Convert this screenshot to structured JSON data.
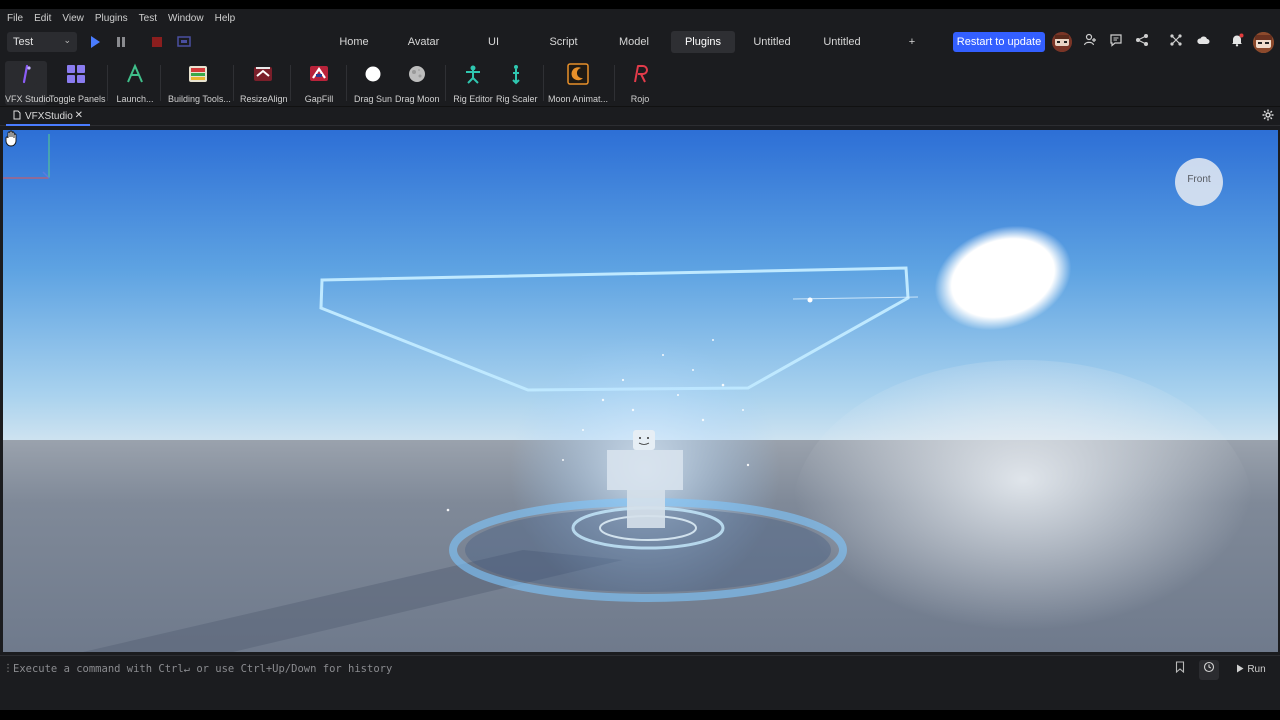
{
  "menu": [
    "File",
    "Edit",
    "View",
    "Plugins",
    "Test",
    "Window",
    "Help"
  ],
  "toolbar": {
    "mode_select": "Test",
    "tabs": [
      {
        "label": "Home",
        "active": false
      },
      {
        "label": "Avatar",
        "active": false
      },
      {
        "label": "UI",
        "active": false
      },
      {
        "label": "Script",
        "active": false
      },
      {
        "label": "Model",
        "active": false
      },
      {
        "label": "Plugins",
        "active": true
      },
      {
        "label": "Untitled",
        "active": false
      },
      {
        "label": "Untitled",
        "active": false
      },
      {
        "label": "+",
        "active": false
      }
    ],
    "restart_label": "Restart to update"
  },
  "plugins": [
    {
      "label": "VFX Studio",
      "icon": "vfx-studio-icon",
      "selected": true
    },
    {
      "label": "Toggle Panels",
      "icon": "toggle-panels-icon"
    },
    {
      "label": "Launch...",
      "icon": "launch-icon"
    },
    {
      "label": "Building Tools...",
      "icon": "building-tools-icon"
    },
    {
      "label": "ResizeAlign",
      "icon": "resize-align-icon"
    },
    {
      "label": "GapFill",
      "icon": "gapfill-icon"
    },
    {
      "label": "Drag Sun",
      "icon": "sun-icon"
    },
    {
      "label": "Drag Moon",
      "icon": "moon-icon"
    },
    {
      "label": "Rig Editor",
      "icon": "rig-editor-icon"
    },
    {
      "label": "Rig Scaler",
      "icon": "rig-scaler-icon"
    },
    {
      "label": "Moon Animat...",
      "icon": "moon-animator-icon"
    },
    {
      "label": "Rojo",
      "icon": "rojo-icon"
    }
  ],
  "document_tab": {
    "label": "VFXStudio",
    "close": "✕"
  },
  "viewport": {
    "gizmo_label": "Front"
  },
  "command_bar": {
    "placeholder": "Execute a command with Ctrl↵ or use Ctrl+Up/Down for history",
    "run_label": "Run"
  },
  "colors": {
    "accent": "#335fff",
    "panel": "#1b1c1f",
    "active_tab": "#2e2f33"
  }
}
